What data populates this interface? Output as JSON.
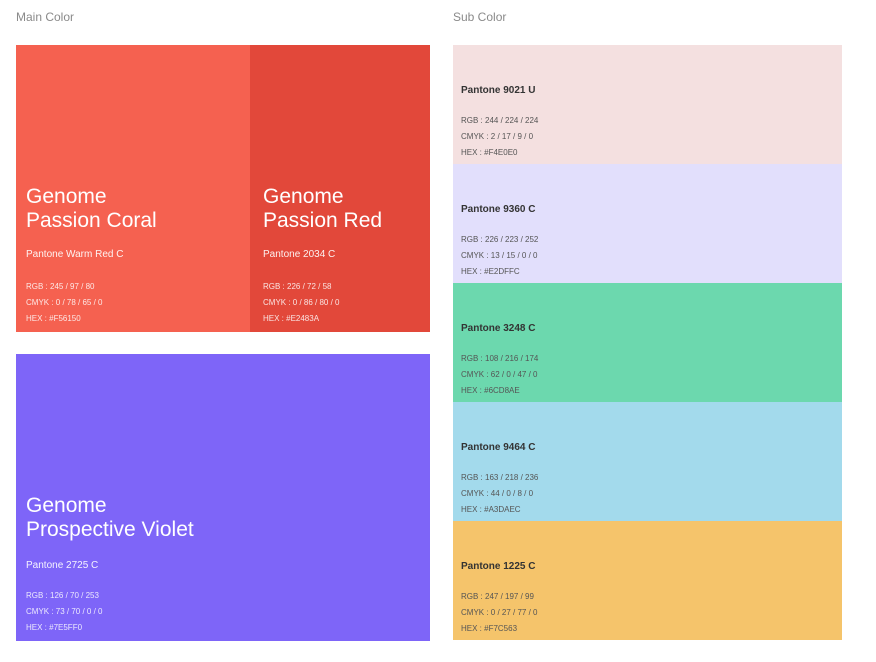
{
  "main": {
    "title": "Main Color",
    "coral": {
      "name_line1": "Genome",
      "name_line2": "Passion Coral",
      "pantone": "Pantone Warm Red C",
      "rgb": "RGB : 245 / 97 / 80",
      "cmyk": "CMYK : 0 / 78 / 65 / 0",
      "hex": "HEX : #F56150",
      "color": "#F56150"
    },
    "red": {
      "name_line1": "Genome",
      "name_line2": "Passion Red",
      "pantone": "Pantone 2034 C",
      "rgb": "RGB : 226 / 72 / 58",
      "cmyk": "CMYK : 0 / 86 / 80 / 0",
      "hex": "HEX : #E2483A",
      "color": "#E2483A"
    },
    "violet": {
      "name_line1": "Genome",
      "name_line2": "Prospective Violet",
      "pantone": "Pantone 2725 C",
      "rgb": "RGB : 126 / 70 / 253",
      "cmyk": "CMYK : 73 / 70 / 0 / 0",
      "hex": "HEX : #7E5FF0",
      "color": "#7E65F8"
    }
  },
  "sub": {
    "title": "Sub Color",
    "items": [
      {
        "pantone": "Pantone 9021 U",
        "rgb": "RGB : 244 / 224 / 224",
        "cmyk": "CMYK : 2 / 17 / 9 / 0",
        "hex": "HEX : #F4E0E0",
        "color": "#F4E0E0"
      },
      {
        "pantone": "Pantone 9360 C",
        "rgb": "RGB : 226 / 223 / 252",
        "cmyk": "CMYK : 13 / 15 / 0 / 0",
        "hex": "HEX : #E2DFFC",
        "color": "#E2DFFC"
      },
      {
        "pantone": "Pantone 3248 C",
        "rgb": "RGB : 108 / 216 / 174",
        "cmyk": "CMYK : 62 / 0 / 47 / 0",
        "hex": "HEX : #6CD8AE",
        "color": "#6CD8AE"
      },
      {
        "pantone": "Pantone 9464 C",
        "rgb": "RGB : 163 / 218 / 236",
        "cmyk": "CMYK : 44 / 0 / 8 / 0",
        "hex": "HEX : #A3DAEC",
        "color": "#A3DAEC"
      },
      {
        "pantone": "Pantone 1225 C",
        "rgb": "RGB : 247 / 197 / 99",
        "cmyk": "CMYK : 0 / 27 / 77 / 0",
        "hex": "HEX : #F7C563",
        "color": "#F5C46B"
      }
    ]
  }
}
